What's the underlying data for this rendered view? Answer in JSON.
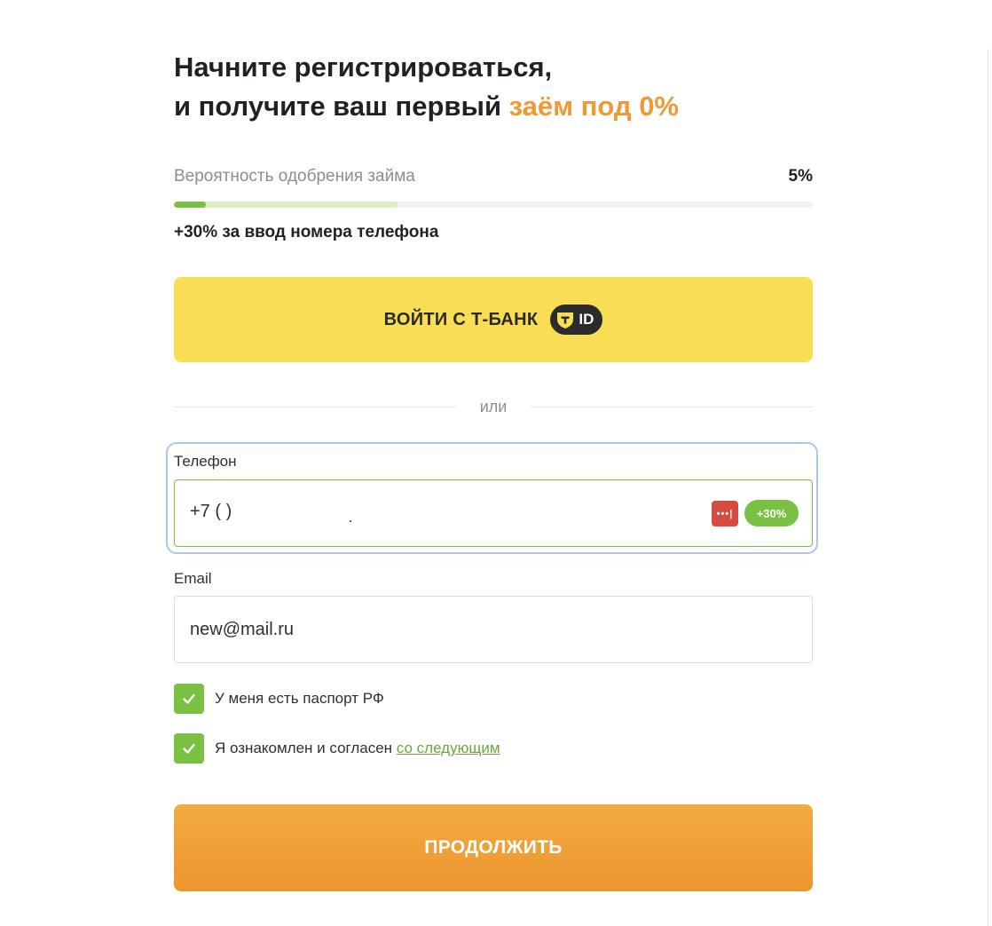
{
  "header": {
    "title_line1": "Начните регистрироваться,",
    "title_line2_prefix": "и получите ваш первый ",
    "title_line2_accent": "заём под 0%"
  },
  "approval": {
    "label": "Вероятность одобрения займа",
    "value_text": "5%",
    "progress_percent": 5,
    "potential_percent": 35,
    "hint": "+30% за ввод номера телефона"
  },
  "tbank_login": {
    "label": "ВОЙТИ С Т-БАНК",
    "badge_text": "ID"
  },
  "divider": {
    "text": "или"
  },
  "form": {
    "phone": {
      "label": "Телефон",
      "value": "+7 (     )",
      "bonus_badge": "+30%",
      "password_manager_icon_text": "•••|"
    },
    "email": {
      "label": "Email",
      "value": "new@mail.ru"
    },
    "checkboxes": [
      {
        "label": "У меня есть паспорт РФ",
        "checked": true
      },
      {
        "label_prefix": "Я ознакомлен и согласен ",
        "link_text": "со следующим",
        "checked": true
      }
    ]
  },
  "continue_button": {
    "label": "ПРОДОЛЖИТЬ"
  },
  "colors": {
    "accent_orange": "#ef9934",
    "brand_yellow": "#f9de55",
    "success_green": "#7ac143",
    "focus_blue": "#a9c8ec"
  }
}
